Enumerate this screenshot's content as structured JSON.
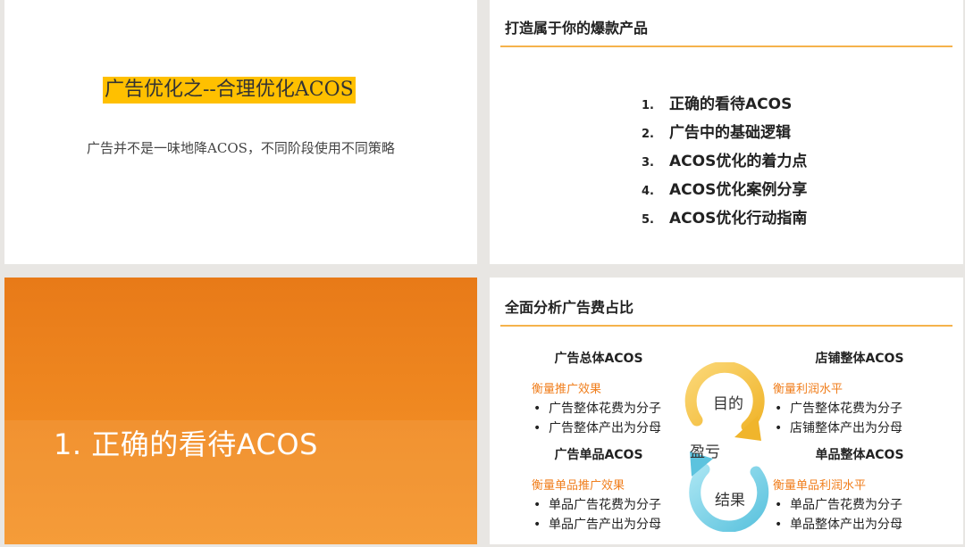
{
  "slide1": {
    "title": "广告优化之--合理优化ACOS",
    "subtitle": "广告并不是一味地降ACOS，不同阶段使用不同策略"
  },
  "slide2": {
    "heading": "打造属于你的爆款产品",
    "items": [
      {
        "num": "1.",
        "text": "正确的看待ACOS"
      },
      {
        "num": "2.",
        "text": "广告中的基础逻辑"
      },
      {
        "num": "3.",
        "text": "ACOS优化的着力点"
      },
      {
        "num": "4.",
        "text": "ACOS优化案例分享"
      },
      {
        "num": "5.",
        "text": "ACOS优化行动指南"
      }
    ]
  },
  "slide3": {
    "title": "1. 正确的看待ACOS"
  },
  "slide4": {
    "heading": "全面分析广告费占比",
    "top_left": {
      "title": "广告总体ACOS",
      "measure": "衡量推广效果",
      "bullets": [
        "广告整体花费为分子",
        "广告整体产出为分母"
      ]
    },
    "top_right": {
      "title": "店铺整体ACOS",
      "measure": "衡量利润水平",
      "bullets": [
        "广告整体花费为分子",
        "店铺整体产出为分母"
      ]
    },
    "bottom_left": {
      "title": "广告单品ACOS",
      "measure": "衡量单品推广效果",
      "bullets": [
        "单品广告花费为分子",
        "单品广告产出为分母"
      ]
    },
    "bottom_right": {
      "title": "单品整体ACOS",
      "measure": "衡量单品利润水平",
      "bullets": [
        "单品广告花费为分子",
        "单品整体产出为分母"
      ]
    },
    "cycle": {
      "top": "目的",
      "middle": "盈亏",
      "bottom": "结果"
    }
  },
  "colors": {
    "accent": "#f07e1c",
    "highlight": "#ffc000",
    "rule": "#f5b24b",
    "cycle_top": "#f5c24a",
    "cycle_bottom": "#7fd3e8"
  }
}
